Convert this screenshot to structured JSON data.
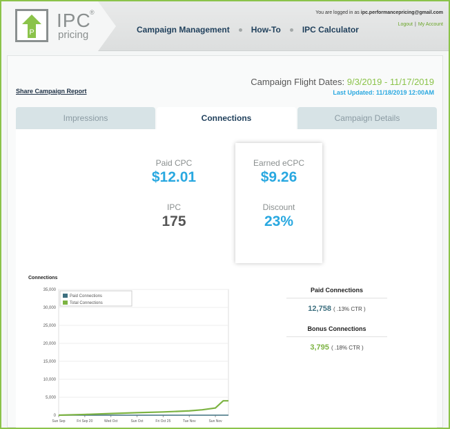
{
  "header": {
    "logo": {
      "line1": "IPC",
      "reg": "®",
      "line2": "pricing",
      "mark_letter": "P"
    },
    "nav": [
      "Campaign Management",
      "How-To",
      "IPC Calculator"
    ],
    "logged_in_prefix": "You are logged in as",
    "user_email": "ipc.performancepricing@gmail.com",
    "logout": "Logout",
    "separator": "|",
    "my_account": "My Account"
  },
  "report": {
    "share_link": "Share Campaign Report",
    "flight_label": "Campaign Flight Dates:",
    "flight_dates": "9/3/2019 - 11/17/2019",
    "last_updated": "Last Updated: 11/18/2019 12:00AM"
  },
  "tabs": [
    {
      "label": "Impressions",
      "active": false
    },
    {
      "label": "Connections",
      "active": true
    },
    {
      "label": "Campaign Details",
      "active": false
    }
  ],
  "metrics": {
    "paid_cpc": {
      "label": "Paid CPC",
      "value": "$12.01"
    },
    "ipc": {
      "label": "IPC",
      "value": "175"
    },
    "earned_ecpc": {
      "label": "Earned eCPC",
      "value": "$9.26"
    },
    "discount": {
      "label": "Discount",
      "value": "23%"
    }
  },
  "stats": {
    "paid": {
      "title": "Paid Connections",
      "value": "12,758",
      "ctr": "( .13% CTR )"
    },
    "bonus": {
      "title": "Bonus Connections",
      "value": "3,795",
      "ctr": "( .18% CTR )"
    }
  },
  "colors": {
    "green": "#8bc34a",
    "blue": "#29a8e0",
    "navy": "#1f3f5b",
    "paid_series": "#3d6f7f",
    "total_series": "#7cb342"
  },
  "chart_data": {
    "type": "line",
    "title": "Connections",
    "yticks": [
      "0",
      "5,000",
      "10,000",
      "15,000",
      "20,000",
      "25,000",
      "30,000",
      "35,000"
    ],
    "ylim": [
      0,
      35000
    ],
    "xticks": [
      "Sun Sep",
      "Fri Sep 20",
      "Wed Oct",
      "Sun Oct",
      "Fri Oct 25",
      "Tue Nov",
      "Sun Nov"
    ],
    "legend_position": "top-left",
    "series": [
      {
        "name": "Paid Connections",
        "x": [
          0,
          1,
          2,
          3,
          4,
          5,
          5.5,
          6,
          6.5
        ],
        "y": [
          0,
          0,
          0,
          0,
          0,
          0,
          0,
          0,
          0
        ]
      },
      {
        "name": "Total Connections",
        "x": [
          0,
          1,
          2,
          3,
          4,
          5,
          5.5,
          6,
          6.3,
          6.5
        ],
        "y": [
          0,
          200,
          450,
          700,
          900,
          1200,
          1500,
          2000,
          4000,
          4000
        ]
      }
    ]
  }
}
